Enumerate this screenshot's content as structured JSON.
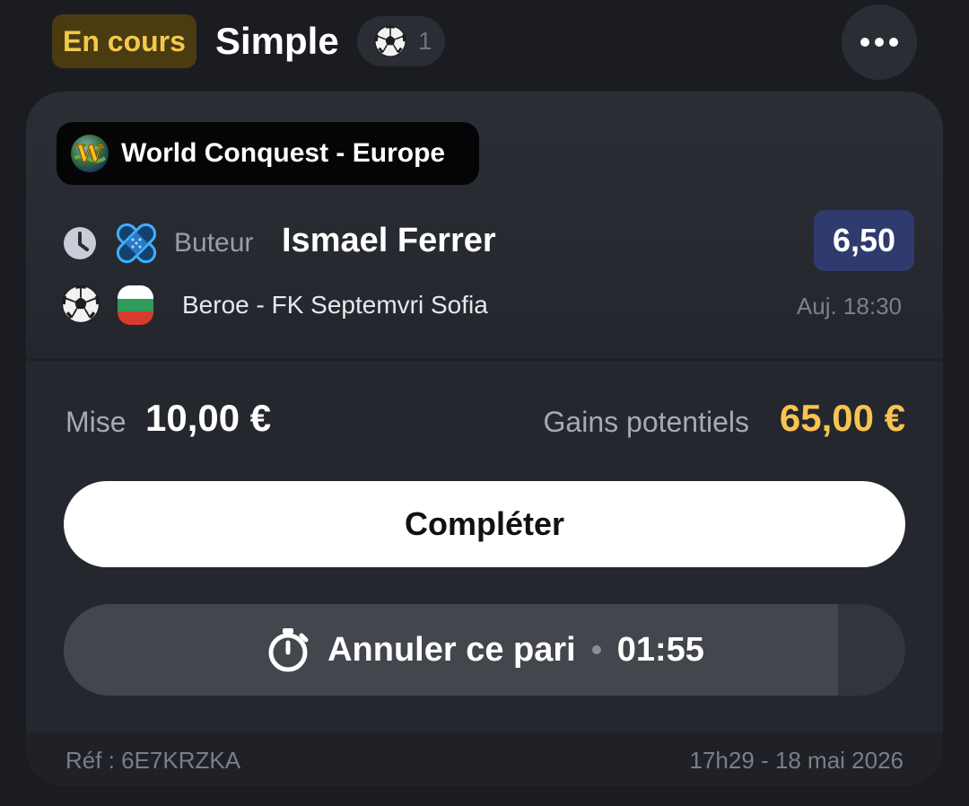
{
  "header": {
    "status": "En cours",
    "bet_type": "Simple",
    "selections_count": "1",
    "status_color": "#f3c84b",
    "more_icon": "more-dots-icon"
  },
  "bet": {
    "league": "World Conquest - Europe",
    "league_icon": "world-conquest-logo-icon",
    "market": "Buteur",
    "selection": "Ismael Ferrer",
    "odds": "6,50",
    "match": "Beroe - FK Septemvri Sofia",
    "kickoff": "Auj. 18:30",
    "sport_icon": "soccer-ball-icon",
    "country_flag": "bulgaria-flag-icon"
  },
  "stake": {
    "label": "Mise",
    "value": "10,00 €",
    "gains_label": "Gains potentiels",
    "gains_value": "65,00 €",
    "gains_color": "#f8c44f"
  },
  "actions": {
    "complete_label": "Compléter",
    "cancel_label": "Annuler ce pari",
    "cancel_timer": "01:55",
    "cancel_progress": 0.92
  },
  "footer": {
    "ref": "Réf : 6E7KRZKA",
    "date": "17h29 - 18 mai 2026"
  }
}
